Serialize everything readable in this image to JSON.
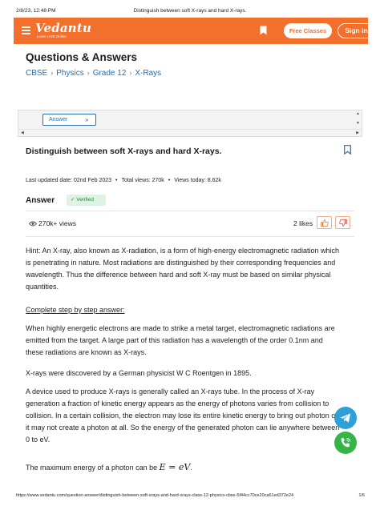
{
  "print_header": {
    "datetime": "2/8/23, 12:48 PM",
    "title": "Distinguish between soft X-rays and hard X-rays."
  },
  "navbar": {
    "logo_text": "Vedantu",
    "logo_tagline": "Learn LIVE Online",
    "free_classes_label": "Free Classes",
    "signin_label": "Sign in",
    "color": "#f26f2c"
  },
  "page": {
    "section_title": "Questions & Answers",
    "breadcrumb": [
      "CBSE",
      "Physics",
      "Grade 12",
      "X-Rays"
    ]
  },
  "answer_panel": {
    "toggle_label": "Answer"
  },
  "question": {
    "title": "Distinguish between soft X-rays and hard X-rays.",
    "last_updated": "Last updated date: 02nd Feb 2023",
    "total_views": "Total views: 270k",
    "views_today": "Views today: 8.62k"
  },
  "answer": {
    "label": "Answer",
    "verified_label": "Verified",
    "views": "270k+ views",
    "likes": "2 likes"
  },
  "content": {
    "hint": "Hint: An X-ray, also known as X-radiation, is a form of high-energy electromagnetic radiation which is penetrating in nature. Most radiations are distinguished by their corresponding frequencies and wavelength. Thus the difference between hard and soft X-ray must be based on similar physical quantities.",
    "step_heading": "Complete step by step answer:",
    "para1": "When highly energetic electrons are made to strike a metal target, electromagnetic radiations are emitted from the target. A large part of this radiation has a wavelength of the order 0.1nm and these radiations are known as X-rays.",
    "para2": "X-rays were discovered by a German physicist W C Roentgen in 1895.",
    "para3": "A device used to produce X-rays is generally called an X-rays tube. In the process of X-ray generation a fraction of kinetic energy appears as the energy of photons varies from collision to collision. In a certain collision, the electron may lose its entire kinetic energy to bring out photon or it may not create a photon at all. So the energy of the generated photon can lie anywhere between 0 to eV.",
    "para4_prefix": "The maximum energy of a photon can be",
    "para4_equation": "E = eV",
    "para4_suffix": "."
  },
  "print_footer": {
    "url": "https://www.vedantu.com/question-answer/distinguish-between-soft-xrays-and-hard-xrays-class-12-physics-cbse-5f44cc70ce20ca61ed372e24",
    "page": "1/6"
  }
}
